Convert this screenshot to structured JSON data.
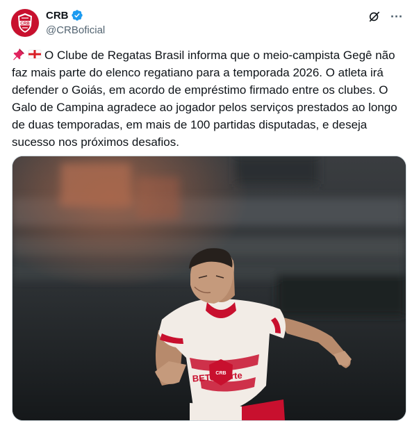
{
  "author": {
    "display_name": "CRB",
    "handle": "@CRBoficial",
    "verified": true,
    "avatar_icon": "crb-club-crest",
    "crest_text": "CRB"
  },
  "actions": {
    "grok_icon": "grok-icon",
    "more_icon": "more-dots-icon",
    "more_label": "···"
  },
  "post": {
    "emojis": [
      "pushpin-emoji",
      "england-flag-emoji"
    ],
    "text": "O Clube de Regatas Brasil informa que o meio-campista Gegê não faz mais parte do elenco regatiano para a temporada 2026. O atleta irá defender o Goiás, em acordo de empréstimo firmado entre os clubes. O Galo de Campina agradece ao jogador pelos serviços prestados ao longo de duas temporadas, em mais de 100 partidas disputadas, e deseja sucesso nos próximos desafios."
  },
  "media": {
    "description_icon": "player-photo",
    "shirt_sponsor": "BETesporte",
    "jersey_crest_text": "CRB"
  },
  "colors": {
    "brand_red": "#c8102e",
    "verified_blue": "#1d9bf0",
    "text_primary": "#0f1419",
    "text_secondary": "#536471"
  }
}
